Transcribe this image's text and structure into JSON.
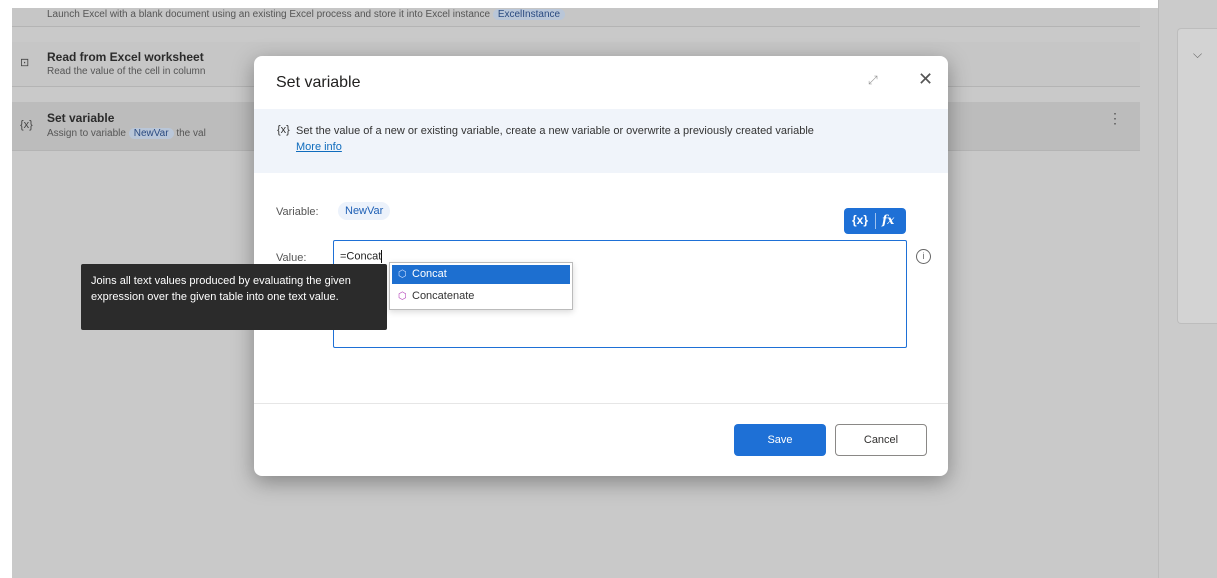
{
  "flow": {
    "launch_text": "Launch Excel with a blank document using an existing Excel process and store it into Excel instance",
    "launch_chip": "ExcelInstance",
    "read": {
      "icon_label": "⊡",
      "title": "Read from Excel worksheet",
      "desc": "Read the value of the cell in column"
    },
    "setvar": {
      "icon_label": "{x}",
      "title": "Set variable",
      "desc_prefix": "Assign to variable",
      "chip": "NewVar",
      "desc_suffix": "the val"
    }
  },
  "dialog": {
    "title": "Set variable",
    "info_icon": "{x}",
    "info_text": "Set the value of a new or existing variable, create a new variable or overwrite a previously created variable",
    "info_link": "More info",
    "variable_label": "Variable:",
    "variable_value": "NewVar",
    "value_label": "Value:",
    "value_text": "=Concat",
    "toolbar": {
      "var_btn": "{x}",
      "fx_btn": "fx"
    },
    "info_circle": "i",
    "save_label": "Save",
    "cancel_label": "Cancel"
  },
  "autocomplete": {
    "items": [
      {
        "label": "Concat",
        "selected": true
      },
      {
        "label": "Concatenate",
        "selected": false
      }
    ]
  },
  "tooltip": {
    "text": "Joins all text values produced by evaluating the given expression over the given table into one text value."
  },
  "colors": {
    "accent": "#1e70d6",
    "tooltip_bg": "#2b2b2b",
    "overlay": "#c9c9c9"
  },
  "icons": {
    "expand": "expand-icon",
    "close": "close-icon",
    "cube": "function-cube-icon",
    "chevron": "chevron-down-icon"
  }
}
